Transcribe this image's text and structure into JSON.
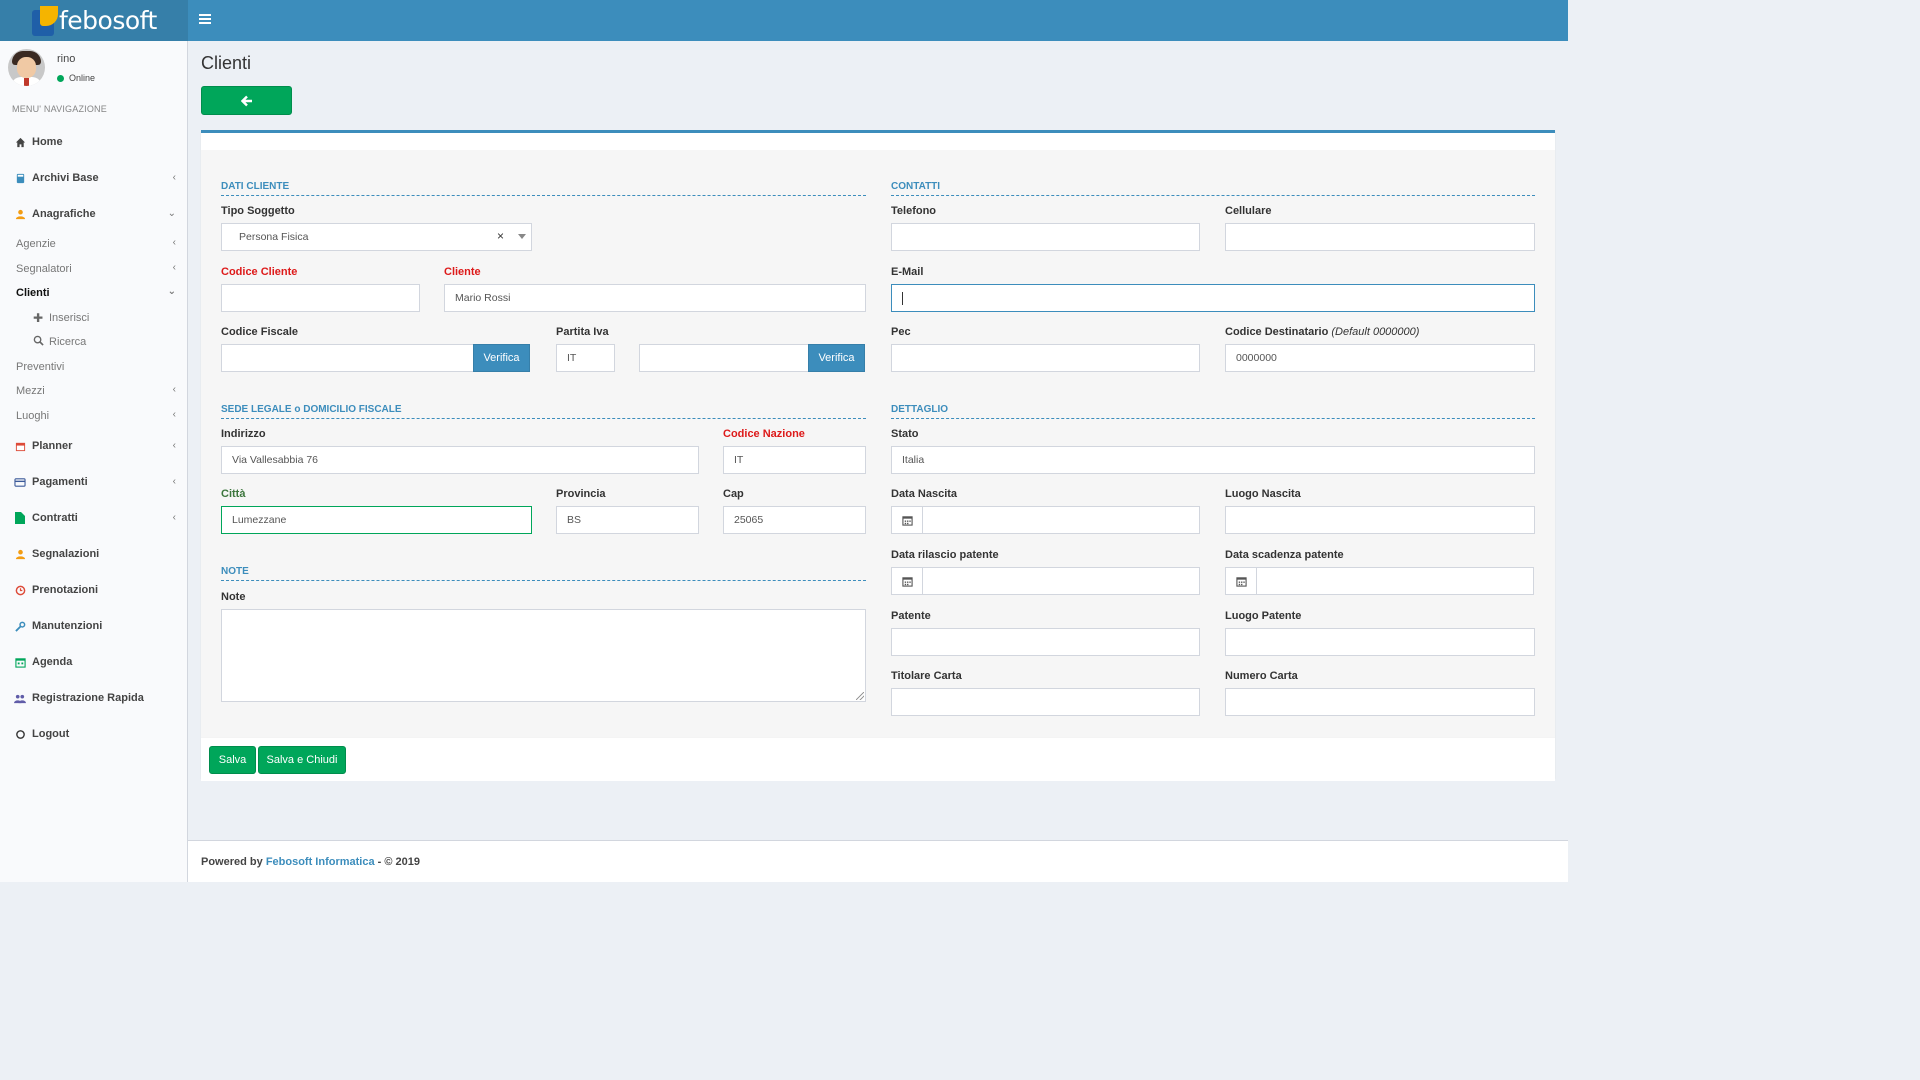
{
  "app": {
    "logo_text": "febosoft"
  },
  "user": {
    "name": "rino",
    "status": "Online"
  },
  "nav": {
    "header": "MENU' NAVIGAZIONE",
    "home": "Home",
    "archivi_base": "Archivi Base",
    "anagrafiche": "Anagrafiche",
    "agenzie": "Agenzie",
    "segnalatori": "Segnalatori",
    "clienti": "Clienti",
    "inserisci": "Inserisci",
    "ricerca": "Ricerca",
    "preventivi": "Preventivi",
    "mezzi": "Mezzi",
    "luoghi": "Luoghi",
    "planner": "Planner",
    "pagamenti": "Pagamenti",
    "contratti": "Contratti",
    "segnalazioni": "Segnalazioni",
    "prenotazioni": "Prenotazioni",
    "manutenzioni": "Manutenzioni",
    "agenda": "Agenda",
    "registrazione_rapida": "Registrazione Rapida",
    "logout": "Logout"
  },
  "page": {
    "title": "Clienti"
  },
  "sections": {
    "dati_cliente": "DATI CLIENTE",
    "contatti": "CONTATTI",
    "sede_legale": "SEDE LEGALE o DOMICILIO FISCALE",
    "dettaglio": "DETTAGLIO",
    "note": "NOTE"
  },
  "fields": {
    "tipo_soggetto": {
      "label": "Tipo Soggetto",
      "value": "Persona Fisica"
    },
    "codice_cliente": {
      "label": "Codice Cliente",
      "value": ""
    },
    "cliente": {
      "label": "Cliente",
      "value": "Mario Rossi"
    },
    "codice_fiscale": {
      "label": "Codice Fiscale",
      "value": ""
    },
    "partita_iva": {
      "label": "Partita Iva",
      "prefix": "IT",
      "value": ""
    },
    "verifica_label": "Verifica",
    "indirizzo": {
      "label": "Indirizzo",
      "value": "Via Vallesabbia 76"
    },
    "codice_nazione": {
      "label": "Codice Nazione",
      "value": "IT"
    },
    "citta": {
      "label": "Città",
      "value": "Lumezzane"
    },
    "provincia": {
      "label": "Provincia",
      "value": "BS"
    },
    "cap": {
      "label": "Cap",
      "value": "25065"
    },
    "note": {
      "label": "Note",
      "value": ""
    },
    "telefono": {
      "label": "Telefono",
      "value": ""
    },
    "cellulare": {
      "label": "Cellulare",
      "value": ""
    },
    "email": {
      "label": "E-Mail",
      "value": ""
    },
    "pec": {
      "label": "Pec",
      "value": ""
    },
    "codice_destinatario": {
      "label": "Codice Destinatario",
      "hint": "(Default 0000000)",
      "value": "0000000"
    },
    "stato": {
      "label": "Stato",
      "value": "Italia"
    },
    "data_nascita": {
      "label": "Data Nascita",
      "value": ""
    },
    "luogo_nascita": {
      "label": "Luogo Nascita",
      "value": ""
    },
    "data_rilascio_patente": {
      "label": "Data rilascio patente",
      "value": ""
    },
    "data_scadenza_patente": {
      "label": "Data scadenza patente",
      "value": ""
    },
    "patente": {
      "label": "Patente",
      "value": ""
    },
    "luogo_patente": {
      "label": "Luogo Patente",
      "value": ""
    },
    "titolare_carta": {
      "label": "Titolare Carta",
      "value": ""
    },
    "numero_carta": {
      "label": "Numero Carta",
      "value": ""
    }
  },
  "buttons": {
    "salva": "Salva",
    "salva_chiudi": "Salva e Chiudi"
  },
  "footer": {
    "powered_by": "Powered by",
    "company": "Febosoft Informatica",
    "copyright": "- © 2019"
  },
  "colors": {
    "primary": "#3c8dbc",
    "success": "#00a65a",
    "required": "#dd1a1a"
  }
}
